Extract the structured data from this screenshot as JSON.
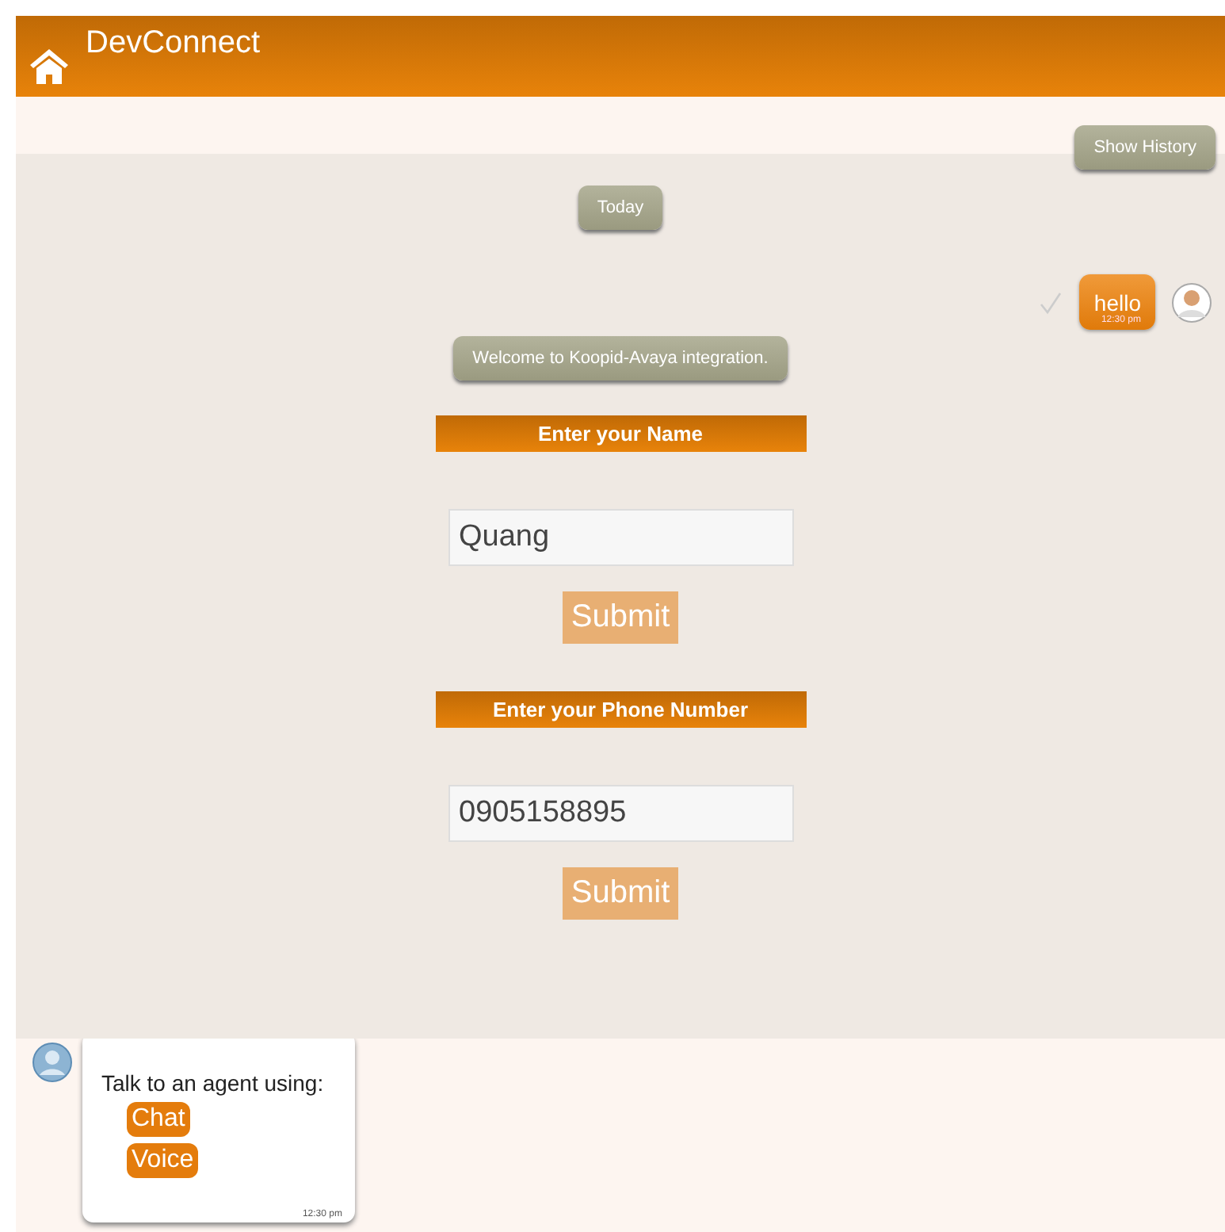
{
  "header": {
    "title": "DevConnect"
  },
  "history_button": "Show History",
  "date_chip": "Today",
  "outgoing": {
    "text": "hello",
    "time": "12:30 pm",
    "delivered": true
  },
  "welcome": "Welcome to Koopid-Avaya integration.",
  "forms": [
    {
      "label": "Enter your Name",
      "value": "Quang",
      "button": "Submit"
    },
    {
      "label": "Enter your Phone Number",
      "value": "0905158895",
      "button": "Submit"
    }
  ],
  "incoming": {
    "text": "Talk to an agent using:",
    "options": [
      "Chat",
      "Voice"
    ],
    "time": "12:30 pm"
  }
}
